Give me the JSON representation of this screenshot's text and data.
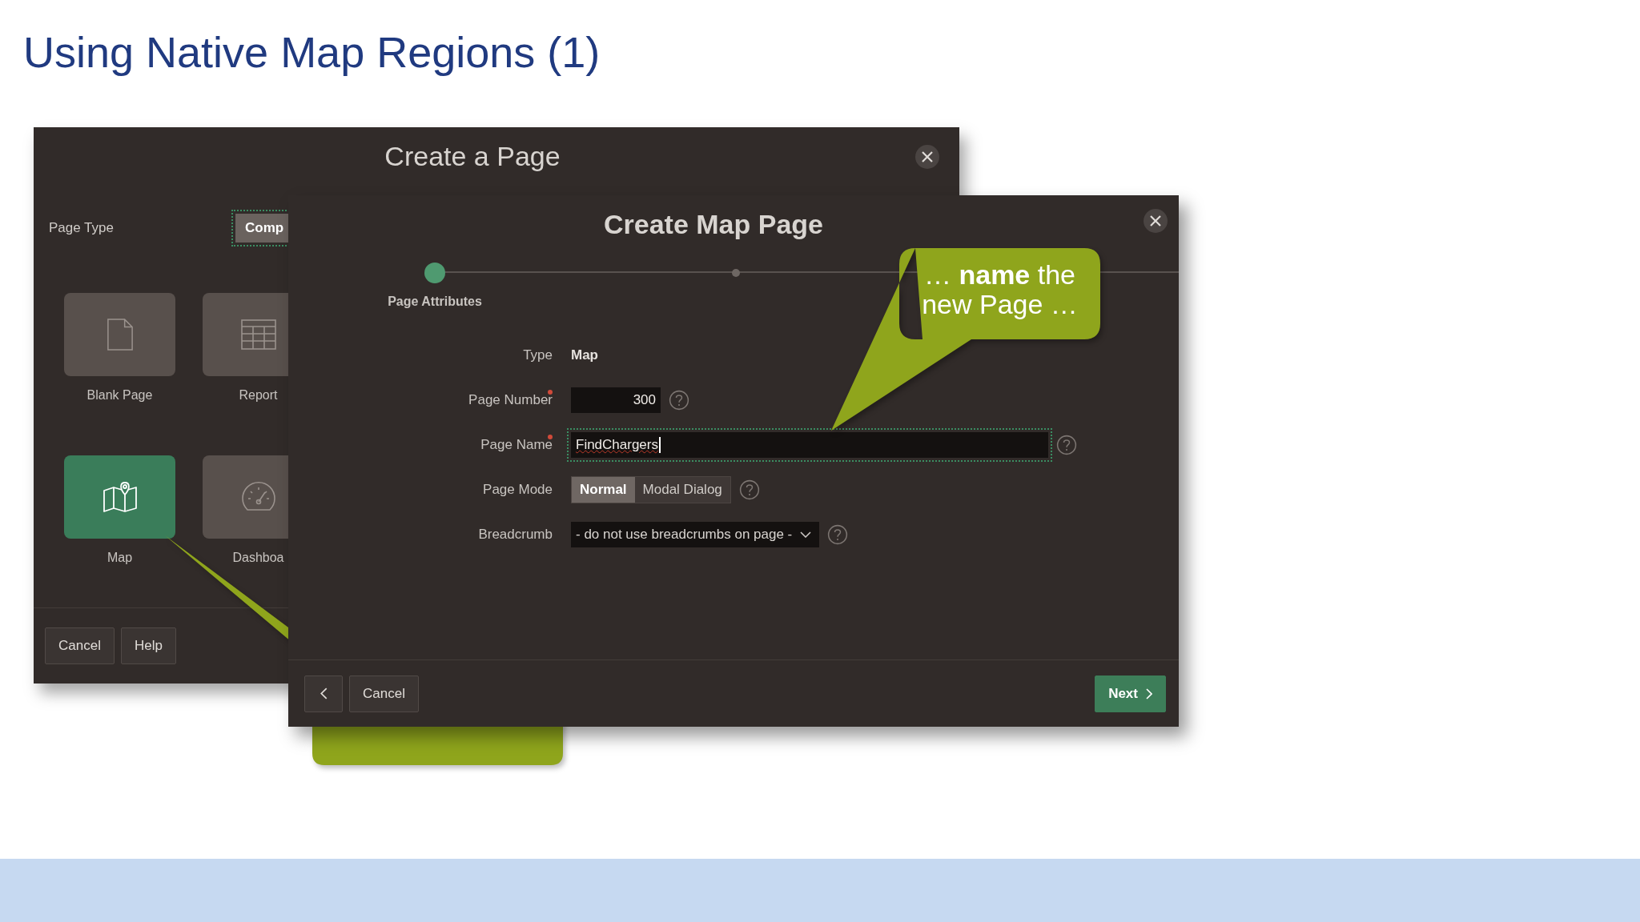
{
  "slide": {
    "title": "Using Native Map Regions (1)"
  },
  "create_page_dialog": {
    "title": "Create a Page",
    "page_type_label": "Page Type",
    "page_type_button": "Comp",
    "tiles": [
      {
        "label": "Blank Page",
        "kind": "blank",
        "selected": false
      },
      {
        "label": "Report",
        "kind": "report",
        "selected": false
      },
      {
        "label": "Map",
        "kind": "map",
        "selected": true
      },
      {
        "label": "Dashboa",
        "kind": "dashboard",
        "selected": false
      }
    ],
    "buttons": [
      "Cancel",
      "Help"
    ]
  },
  "map_page_dialog": {
    "title": "Create Map Page",
    "steps": [
      {
        "label": "Page Attributes",
        "selected": true
      },
      {
        "selected": false
      }
    ],
    "fields": [
      {
        "label": "Type",
        "kind": "display",
        "value": "Map",
        "required": false,
        "help": false
      },
      {
        "label": "Page Number",
        "kind": "number",
        "value": "300",
        "required": true,
        "help": true
      },
      {
        "label": "Page Name",
        "kind": "text",
        "value": "FindChargers",
        "required": true,
        "help": true,
        "focused": true
      },
      {
        "label": "Page Mode",
        "kind": "segmented",
        "required": false,
        "help": true,
        "options": [
          {
            "label": "Normal",
            "selected": true
          },
          {
            "label": "Modal Dialog",
            "selected": false
          }
        ]
      },
      {
        "label": "Breadcrumb",
        "kind": "select",
        "value": "- do not use breadcrumbs on page -",
        "required": false,
        "help": true
      }
    ],
    "cancel_button": "Cancel",
    "next_button": "Next"
  },
  "callout": {
    "text": "… **name** the new Page …"
  }
}
